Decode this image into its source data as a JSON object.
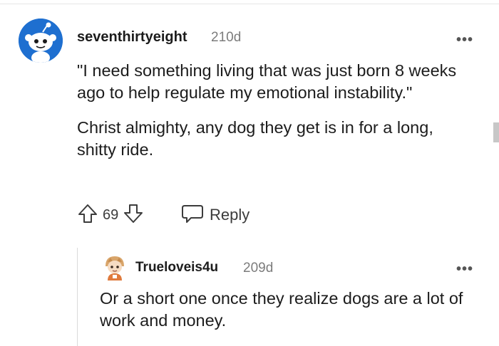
{
  "comment": {
    "username": "seventhirtyeight",
    "age": "210d",
    "more_label": "•••",
    "paragraphs": [
      "\"I need something living that was just born 8 weeks ago to help regulate my emotional instability.\"",
      "Christ almighty, any dog they get is in for a long, shitty ride."
    ],
    "vote_count": "69",
    "reply_label": "Reply",
    "icons": [
      "snoo-avatar",
      "upvote-icon",
      "downvote-icon",
      "comment-bubble-icon",
      "more-options-icon"
    ]
  },
  "reply": {
    "username": "Trueloveis4u",
    "age": "209d",
    "more_label": "•••",
    "body": "Or a short one once they realize dogs are a lot of work and money."
  },
  "colors": {
    "avatar_blue": "#1e6fd0",
    "text": "#1c1c1c",
    "meta": "#7c7c7c"
  }
}
